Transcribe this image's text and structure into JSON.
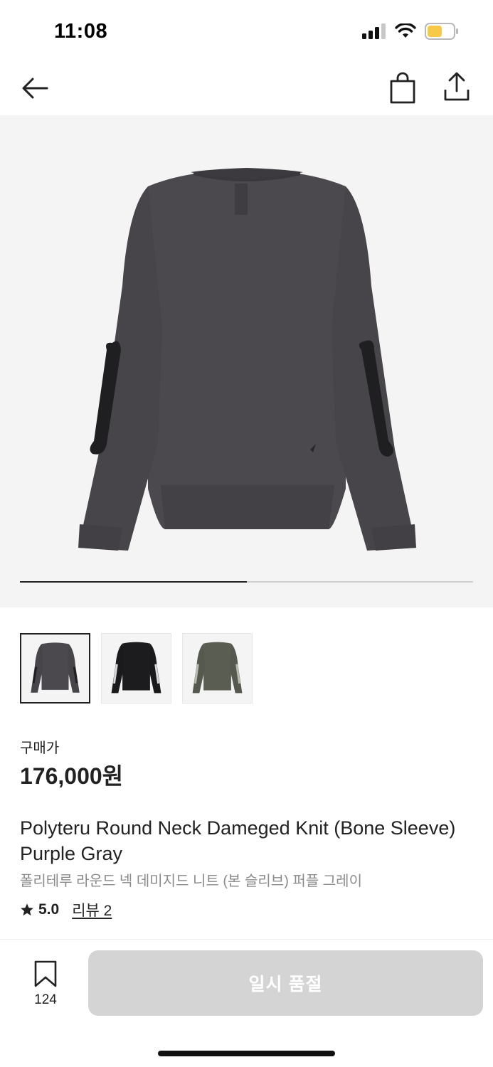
{
  "status": {
    "time": "11:08"
  },
  "nav": {
    "back_icon": "arrow-left-icon",
    "cart_icon": "shopping-bag-icon",
    "share_icon": "share-upload-icon"
  },
  "gallery": {
    "progress": 0.5,
    "image_count": 2,
    "thumbnail_count": 3
  },
  "product": {
    "price_label": "구매가",
    "price": "176,000원",
    "title_en": "Polyteru Round Neck Dameged Knit (Bone Sleeve) Purple Gray",
    "title_ko": "폴리테루 라운드 넥 데미지드 니트 (본 슬리브) 퍼플 그레이",
    "rating": "5.0",
    "reviews": "리뷰 2"
  },
  "bottom_bar": {
    "wish_count": "124",
    "buy_label": "일시 품절",
    "buy_disabled": true
  },
  "colors": {
    "accent_dark": "#222222",
    "button_disabled": "#d4d4d4",
    "hero_bg": "#f4f4f4",
    "knit_purple_gray": "#4a474d",
    "knit_black": "#1c1c1e",
    "knit_olive": "#5a5d52",
    "battery_yellow": "#f7c948"
  }
}
